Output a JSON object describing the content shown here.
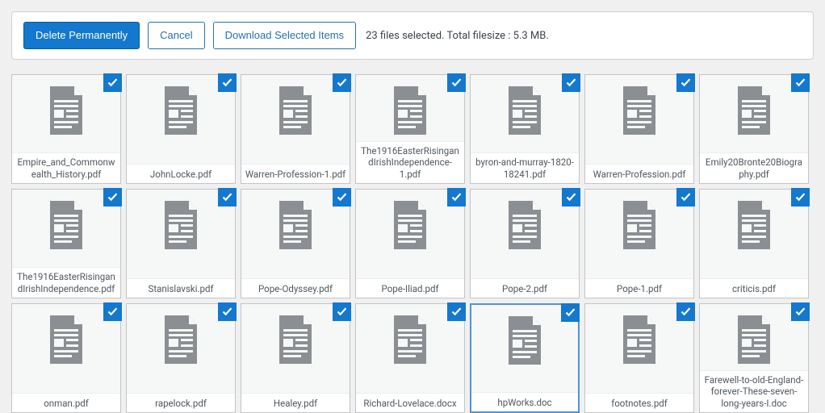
{
  "toolbar": {
    "delete_label": "Delete Permanently",
    "cancel_label": "Cancel",
    "download_label": "Download Selected Items",
    "status": "23 files selected. Total filesize : 5.3 MB."
  },
  "files": [
    {
      "name": "Empire_and_Commonwealth_History.pdf",
      "selected": true,
      "highlight": false
    },
    {
      "name": "JohnLocke.pdf",
      "selected": true,
      "highlight": false
    },
    {
      "name": "Warren-Profession-1.pdf",
      "selected": true,
      "highlight": false
    },
    {
      "name": "The1916EasterRisingandIrishIndependence-1.pdf",
      "selected": true,
      "highlight": false
    },
    {
      "name": "byron-and-murray-1820-18241.pdf",
      "selected": true,
      "highlight": false
    },
    {
      "name": "Warren-Profession.pdf",
      "selected": true,
      "highlight": false
    },
    {
      "name": "Emily20Bronte20Biography.pdf",
      "selected": true,
      "highlight": false
    },
    {
      "name": "The1916EasterRisingandIrishIndependence.pdf",
      "selected": true,
      "highlight": false
    },
    {
      "name": "Stanislavski.pdf",
      "selected": true,
      "highlight": false
    },
    {
      "name": "Pope-Odyssey.pdf",
      "selected": true,
      "highlight": false
    },
    {
      "name": "Pope-Iliad.pdf",
      "selected": true,
      "highlight": false
    },
    {
      "name": "Pope-2.pdf",
      "selected": true,
      "highlight": false
    },
    {
      "name": "Pope-1.pdf",
      "selected": true,
      "highlight": false
    },
    {
      "name": "criticis.pdf",
      "selected": true,
      "highlight": false
    },
    {
      "name": "onman.pdf",
      "selected": true,
      "highlight": false
    },
    {
      "name": "rapelock.pdf",
      "selected": true,
      "highlight": false
    },
    {
      "name": "Healey.pdf",
      "selected": true,
      "highlight": false
    },
    {
      "name": "Richard-Lovelace.docx",
      "selected": true,
      "highlight": false
    },
    {
      "name": "hpWorks.doc",
      "selected": true,
      "highlight": true
    },
    {
      "name": "footnotes.pdf",
      "selected": true,
      "highlight": false
    },
    {
      "name": "Farewell-to-old-England-forever-These-seven-long-years-I.doc",
      "selected": true,
      "highlight": false
    }
  ]
}
